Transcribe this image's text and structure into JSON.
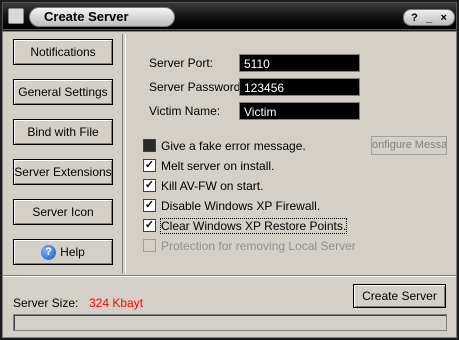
{
  "window": {
    "title": "Create Server",
    "controls": {
      "help": "?",
      "minimize": "_",
      "close": "×"
    }
  },
  "sidebar": {
    "items": [
      {
        "label": "Notifications"
      },
      {
        "label": "General Settings"
      },
      {
        "label": "Bind with File"
      },
      {
        "label": "Server Extensions"
      },
      {
        "label": "Server Icon"
      },
      {
        "label": "Help",
        "icon": "help-icon"
      }
    ]
  },
  "settings": {
    "port_label": "Server Port:",
    "port_value": "5110",
    "password_label": "Server Password:",
    "password_value": "123456",
    "victim_label": "Victim Name:",
    "victim_value": "Victim"
  },
  "options": [
    {
      "label": "Give a fake error message.",
      "state": "filled"
    },
    {
      "label": "Melt server on install.",
      "state": "checked"
    },
    {
      "label": "Kill AV-FW on start.",
      "state": "checked"
    },
    {
      "label": "Disable Windows XP Firewall.",
      "state": "checked"
    },
    {
      "label": "Clear Windows XP Restore Points.",
      "state": "checked"
    },
    {
      "label": "Protection for removing Local Server",
      "state": "disabled"
    }
  ],
  "configure_button": "onfigure Messag",
  "footer": {
    "size_label": "Server Size:",
    "size_value": "324 Kbayt",
    "size_color": "#ff0000",
    "create_button": "Create Server",
    "progress": 0
  }
}
